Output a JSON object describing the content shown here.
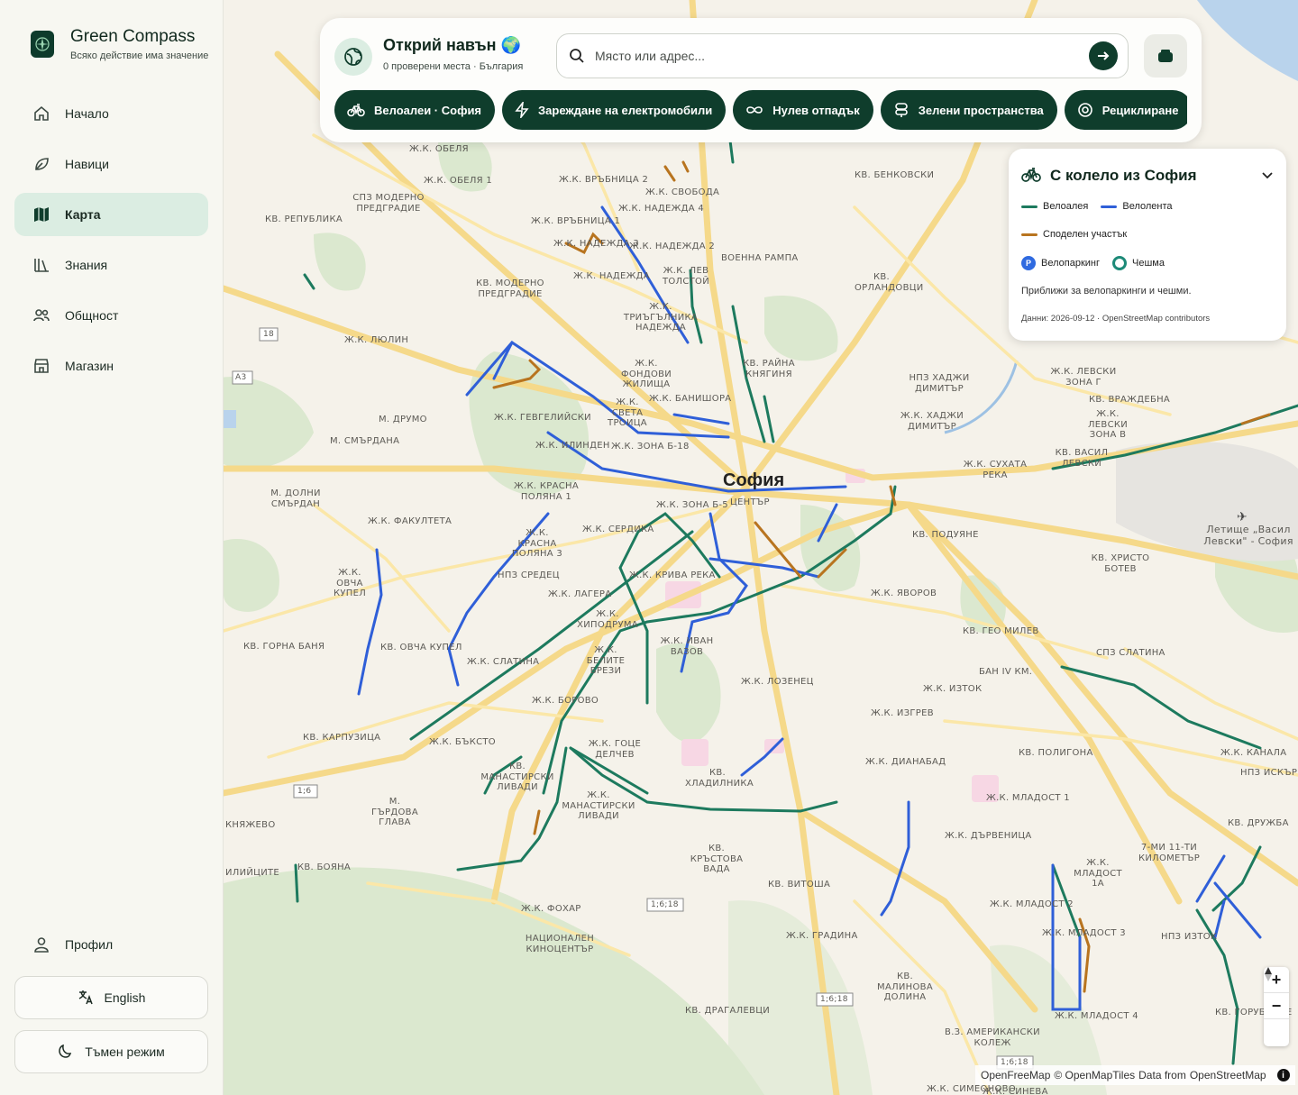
{
  "brand": {
    "title": "Green Compass",
    "subtitle": "Всяко действие има значение"
  },
  "nav": {
    "items": [
      {
        "label": "Начало",
        "icon": "home-icon"
      },
      {
        "label": "Навици",
        "icon": "leaf-icon"
      },
      {
        "label": "Карта",
        "icon": "map-icon",
        "active": true
      },
      {
        "label": "Знания",
        "icon": "library-icon"
      },
      {
        "label": "Общност",
        "icon": "users-icon"
      },
      {
        "label": "Магазин",
        "icon": "store-icon"
      }
    ],
    "profile": "Профил",
    "language": "English",
    "theme": "Тъмен режим"
  },
  "top_panel": {
    "title": "Открий навън 🌍",
    "subtitle": "0 проверени места · България",
    "search_placeholder": "Място или адрес...",
    "chips": [
      {
        "label": "Велоалеи · София",
        "icon": "bike-icon"
      },
      {
        "label": "Зареждане на електромобили",
        "icon": "bolt-icon"
      },
      {
        "label": "Нулев отпадък",
        "icon": "infinity-icon"
      },
      {
        "label": "Зелени пространства",
        "icon": "tree-icon"
      },
      {
        "label": "Рециклиране",
        "icon": "recycle-icon"
      }
    ]
  },
  "legend": {
    "title": "С колело из София",
    "items": {
      "cycle_path": "Велоалея",
      "cycle_lane": "Велолента",
      "shared": "Споделен участък",
      "parking": "Велопаркинг",
      "fountain": "Чешма"
    },
    "parking_letter": "P",
    "note": "Приближи за велопаркинги и чешми.",
    "source": "Данни: 2026-09-12 · OpenStreetMap contributors",
    "colors": {
      "cycle_path": "#1d7a5e",
      "cycle_lane": "#2f5fd8",
      "shared": "#b8741f",
      "parking": "#2f6ae0",
      "fountain": "#1d8a78"
    }
  },
  "map": {
    "city": "София",
    "labels": [
      "Ж.К. ОБЕЛЯ",
      "Ж.К. ОБЕЛЯ 1",
      "Ж.К. ВРЪБНИЦА 2",
      "Ж.К. СВОБОДА",
      "Ж.К. НАДЕЖДА 4",
      "КВ. БЕНКОВСКИ",
      "СПЗ МОДЕРНО ПРЕДГРАДИЕ",
      "КВ. РЕПУБЛИКА",
      "Ж.К. ВРЪБНИЦА 1",
      "Ж.К. НАДЕЖДА 3",
      "Ж.К. НАДЕЖДА 2",
      "ВОЕННА РАМПА",
      "КВ. МОДЕРНО ПРЕДГРАДИЕ",
      "Ж.К. НАДЕЖДА",
      "Ж.К. ЛЕВ ТОЛСТОЙ",
      "КВ. ОРЛАНДОВЦИ",
      "Ж.К. ТРИЪГЪЛНИКА НАДЕЖДА",
      "Ж.К. ЛЮЛИН",
      "Ж.К. ФОНДОВИ ЖИЛИЩА",
      "КВ. РАЙНА КНЯГИНЯ",
      "НПЗ ХАДЖИ ДИМИТЪР",
      "Ж.К. ЛЕВСКИ ЗОНА Г",
      "Ж.К. СВЕТА ТРОИЦА",
      "Ж.К. БАНИШОРА",
      "КВ. ВРАЖДЕБНА",
      "Ж.К. ГЕВГЕЛИЙСКИ",
      "М. ДРУМО",
      "Ж.К. ХАДЖИ ДИМИТЪР",
      "Ж.К. ЛЕВСКИ ЗОНА В",
      "М. СМЪРДАНА",
      "Ж.К. ИЛИНДЕН",
      "Ж.К. ЗОНА Б-18",
      "Ж.К. СУХАТА РЕКА",
      "КВ. ВАСИЛ ЛЕВСКИ",
      "Ж.К. КРАСНА ПОЛЯНА 1",
      "ЦЕНТЪР",
      "Ж.К. ЗОНА Б-5",
      "М. ДОЛНИ СМЪРДАН",
      "Летище „Васил Левски\" - София",
      "Ж.К. ФАКУЛТЕТА",
      "Ж.К. СЕРДИКА",
      "КВ. ПОДУЯНЕ",
      "Ж.К. КРАСНА ПОЛЯНА 3",
      "НПЗ СРЕДЕЦ",
      "Ж.К. КРИВА РЕКА",
      "КВ. ХРИСТО БОТЕВ",
      "Ж.К. ОВЧА КУПЕЛ",
      "Ж.К. ЛАГЕРА",
      "Ж.К. ЯВОРОВ",
      "Ж.К. ХИПОДРУМА",
      "КВ. ГЕО МИЛЕВ",
      "КВ. ГОРНА БАНЯ",
      "КВ. ОВЧА КУПЕЛ",
      "Ж.К. БЕЛИТЕ БРЕЗИ",
      "Ж.К. ИВАН ВАЗОВ",
      "СПЗ СЛАТИНА",
      "Ж.К. СЛАТИНА",
      "БАН IV КМ.",
      "Ж.К. ЛОЗЕНЕЦ",
      "Ж.К. БОРОВО",
      "Ж.К. ИЗТОК",
      "Ж.К. ИЗГРЕВ",
      "КВ. КАРПУЗИЦА",
      "Ж.К. БЪКСТО",
      "Ж.К. ГОЦЕ ДЕЛЧЕВ",
      "КВ. ПОЛИГОНА",
      "Ж.К. КАНАЛА",
      "КВ. МАНАСТИРСКИ ЛИВАДИ",
      "КВ. ХЛАДИЛНИКА",
      "Ж.К. ДИАНАБАД",
      "НПЗ ИСКЪР",
      "М. ГЪРДОВА ГЛАВА",
      "Ж.К. МАНАСТИРСКИ ЛИВАДИ",
      "Ж.К. МЛАДОСТ 1",
      "КВ. ДРУЖБА",
      "КНЯЖЕВО",
      "Ж.К. ДЪРВЕНИЦА",
      "КВ. КРЪСТОВА ВАДА",
      "Ж.К. МЛАДОСТ 1А",
      "7-МИ 11-ТИ КИЛОМЕТЪР",
      "ИЛИЙЦИТЕ",
      "КВ. БОЯНА",
      "КВ. ВИТОША",
      "Ж.К. МЛАДОСТ 2",
      "Ж.К. ФОХАР",
      "Ж.К. МЛАДОСТ 3",
      "НПЗ ИЗТОК",
      "НАЦИОНАЛЕН КИНОЦЕНТЪР",
      "Ж.К. ГРАДИНА",
      "КВ. МАЛИНОВА ДОЛИНА",
      "Ж.К. МЛАДОСТ 4",
      "КВ. ДРАГАЛЕВЦИ",
      "В.З. АМЕРИКАНСКИ КОЛЕЖ",
      "КВ. ГОРУБЛЯНЕ",
      "Ж.К. СИМЕОНОВО",
      "Ж.К. СИНЕВА"
    ],
    "road_shields": [
      "18",
      "A3",
      "1;6",
      "1;6;18",
      "1;6;18",
      "1;6;18"
    ],
    "attribution": {
      "a": "OpenFreeMap",
      "b": "© OpenMapTiles",
      "c": "Data from",
      "d": "OpenStreetMap"
    },
    "zoom_in": "+",
    "zoom_out": "−"
  }
}
